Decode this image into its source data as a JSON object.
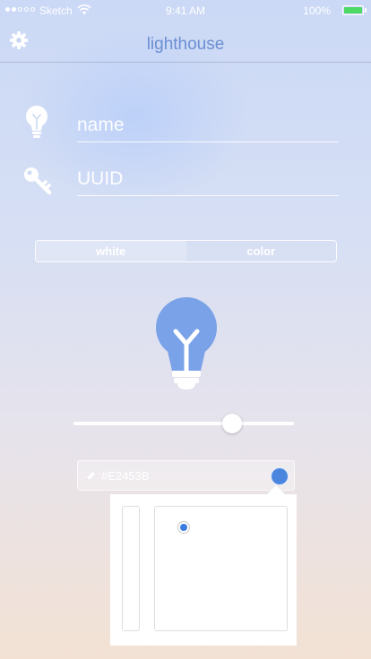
{
  "status_bar": {
    "carrier": "Sketch",
    "time": "9:41 AM",
    "battery": "100%",
    "signal_bars_filled": 2,
    "signal_bars_total": 5,
    "battery_level": 1.0
  },
  "nav": {
    "title": "lighthouse",
    "settings_icon": "gear-icon"
  },
  "form": {
    "name_placeholder": "name",
    "name_icon": "lightbulb-icon",
    "uuid_placeholder": "UUID",
    "uuid_icon": "key-icon"
  },
  "mode_toggle": {
    "options": [
      "white",
      "color"
    ],
    "selected": "white"
  },
  "brightness": {
    "value": 0.72
  },
  "color": {
    "hex_text": "#E2453B",
    "edit_icon": "pencil-icon",
    "swatch_color": "#4a86de"
  },
  "colors": {
    "accent": "#6b8fd2",
    "bulb": "#7aa2e8",
    "battery_fill": "#4cd964",
    "picker_dot": "#3a7be0"
  }
}
